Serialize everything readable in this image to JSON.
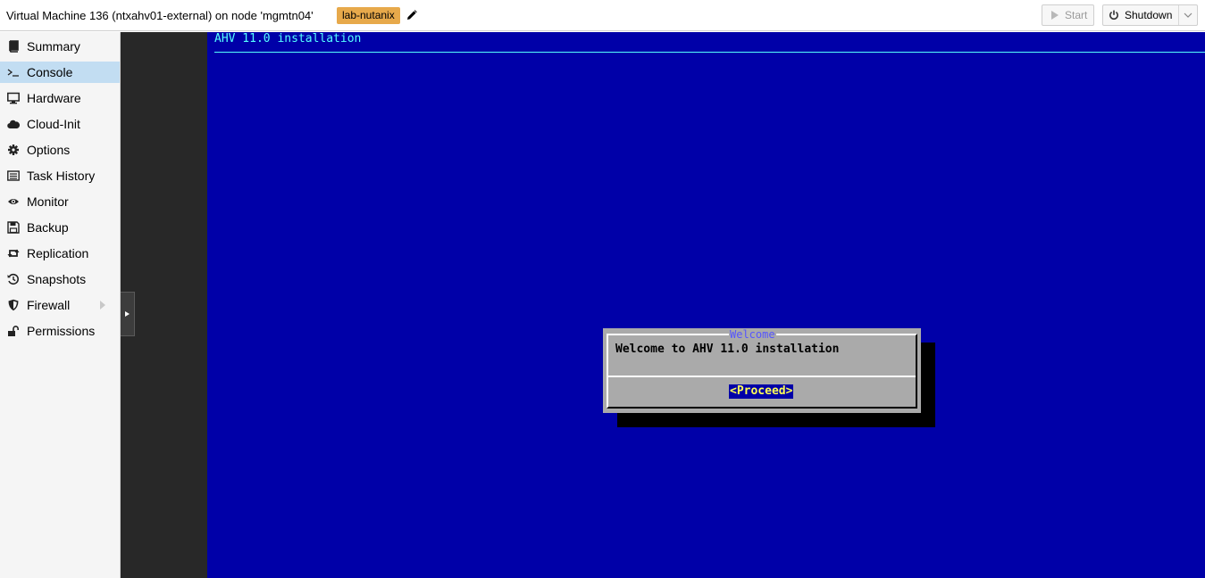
{
  "header": {
    "title": "Virtual Machine 136 (ntxahv01-external) on node 'mgmtn04'",
    "tag": "lab-nutanix",
    "edit_icon": "pencil-icon",
    "start_label": "Start",
    "shutdown_label": "Shutdown"
  },
  "sidebar": {
    "items": [
      {
        "label": "Summary",
        "icon": "book-icon"
      },
      {
        "label": "Console",
        "icon": "terminal-icon",
        "active": true
      },
      {
        "label": "Hardware",
        "icon": "monitor-icon"
      },
      {
        "label": "Cloud-Init",
        "icon": "cloud-icon"
      },
      {
        "label": "Options",
        "icon": "gear-icon"
      },
      {
        "label": "Task History",
        "icon": "list-icon"
      },
      {
        "label": "Monitor",
        "icon": "eye-icon"
      },
      {
        "label": "Backup",
        "icon": "floppy-icon"
      },
      {
        "label": "Replication",
        "icon": "retweet-icon"
      },
      {
        "label": "Snapshots",
        "icon": "history-icon"
      },
      {
        "label": "Firewall",
        "icon": "shield-icon",
        "has_submenu": true
      },
      {
        "label": "Permissions",
        "icon": "unlock-icon"
      }
    ]
  },
  "console": {
    "screen_title": "AHV 11.0 installation",
    "dialog": {
      "title": "Welcome",
      "message": "Welcome to AHV 11.0 installation",
      "button": "<Proceed>"
    },
    "colors": {
      "screen_bg": "#0000a8",
      "title_color": "#55ffff",
      "dialog_bg": "#aaaaaa",
      "button_text": "#ffff55"
    }
  }
}
